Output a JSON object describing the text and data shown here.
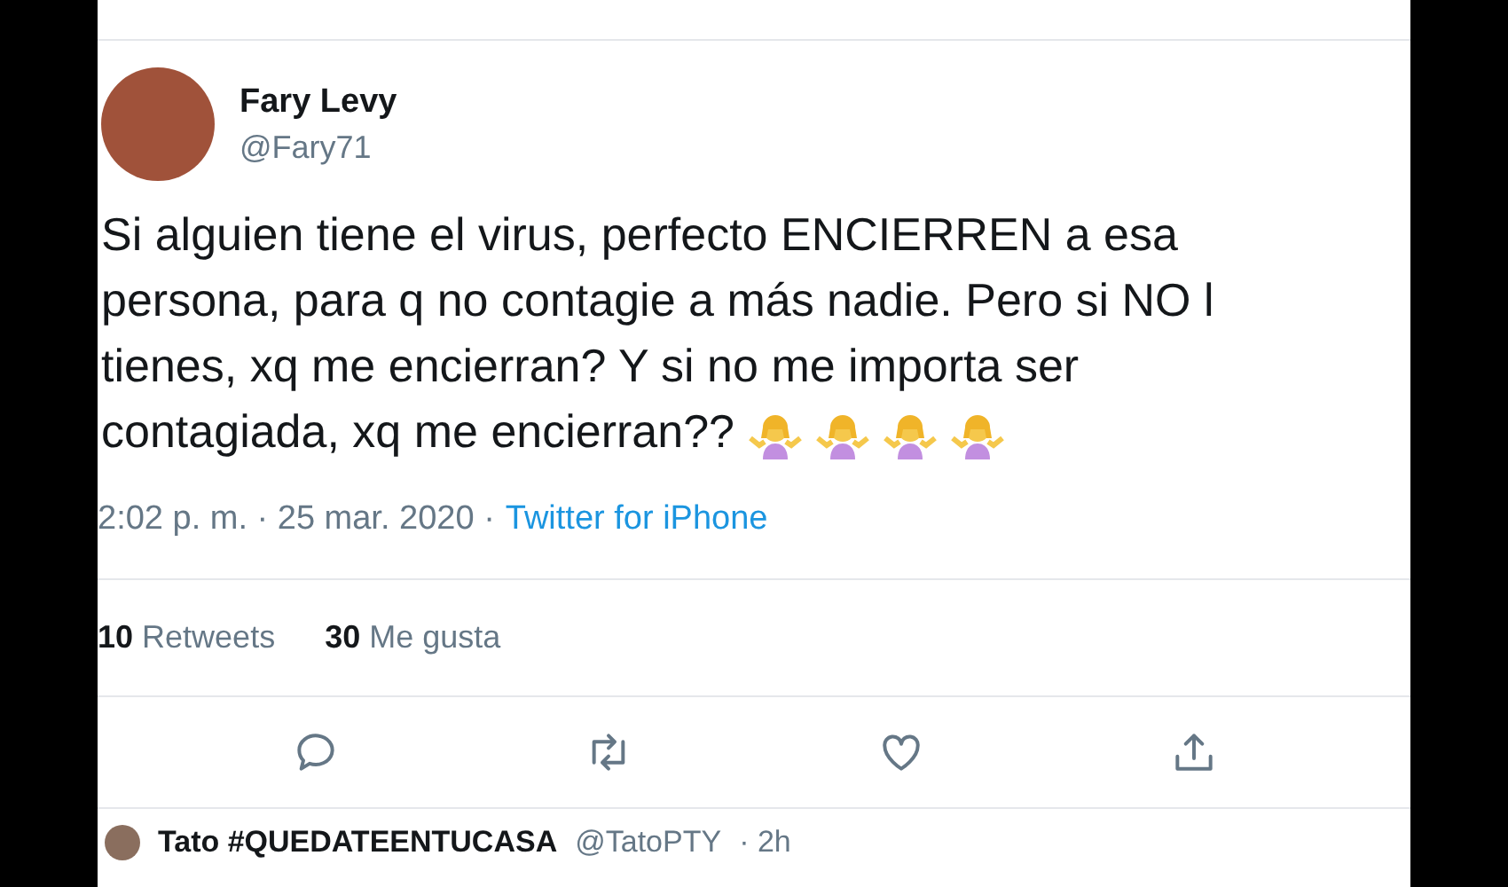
{
  "tweet": {
    "author": {
      "name": "Fary Levy",
      "handle": "@Fary71"
    },
    "text_lines": [
      "Si alguien tiene el virus, perfecto ENCIERREN a esa",
      "persona, para q no contagie a más nadie. Pero si NO l",
      "tienes, xq me encierran? Y si no me importa ser",
      "contagiada, xq me encierran??"
    ],
    "emoji": [
      {
        "kind": "shrug"
      },
      {
        "kind": "shrug"
      },
      {
        "kind": "shrug"
      },
      {
        "kind": "shrug"
      }
    ],
    "time": "2:02 p. m. · 25 mar. 2020 ·",
    "source": "Twitter for iPhone",
    "stats": [
      {
        "count": "10",
        "label": "Retweets"
      },
      {
        "count": "30",
        "label": "Me gusta"
      }
    ],
    "actions": [
      {
        "kind": "reply"
      },
      {
        "kind": "retweet"
      },
      {
        "kind": "like"
      },
      {
        "kind": "share"
      }
    ]
  },
  "next_tweet": {
    "name": "Tato #QUEDATEENTUCASA",
    "handle": "@TatoPTY",
    "time": "· 2h"
  }
}
